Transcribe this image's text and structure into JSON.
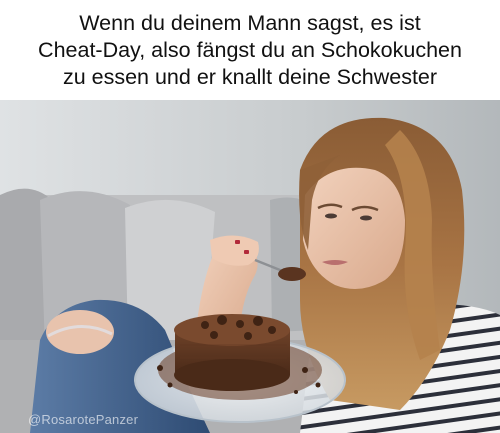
{
  "meme": {
    "caption": "Wenn du deinem Mann sagst, es ist\nCheat-Day, also fängst du an Schokokuchen\nzu essen und er knallt deine Schwester",
    "watermark": "@RosarotePanzer"
  },
  "colors": {
    "caption_background": "#ffffff",
    "caption_text": "#111111",
    "wall": "#c9cdd0",
    "sofa": "#b9babc",
    "jeans": "#3a5a86",
    "hair": "#9a6a3e",
    "cake": "#5a3420",
    "shirt_stripe": "#2c2f3a"
  }
}
